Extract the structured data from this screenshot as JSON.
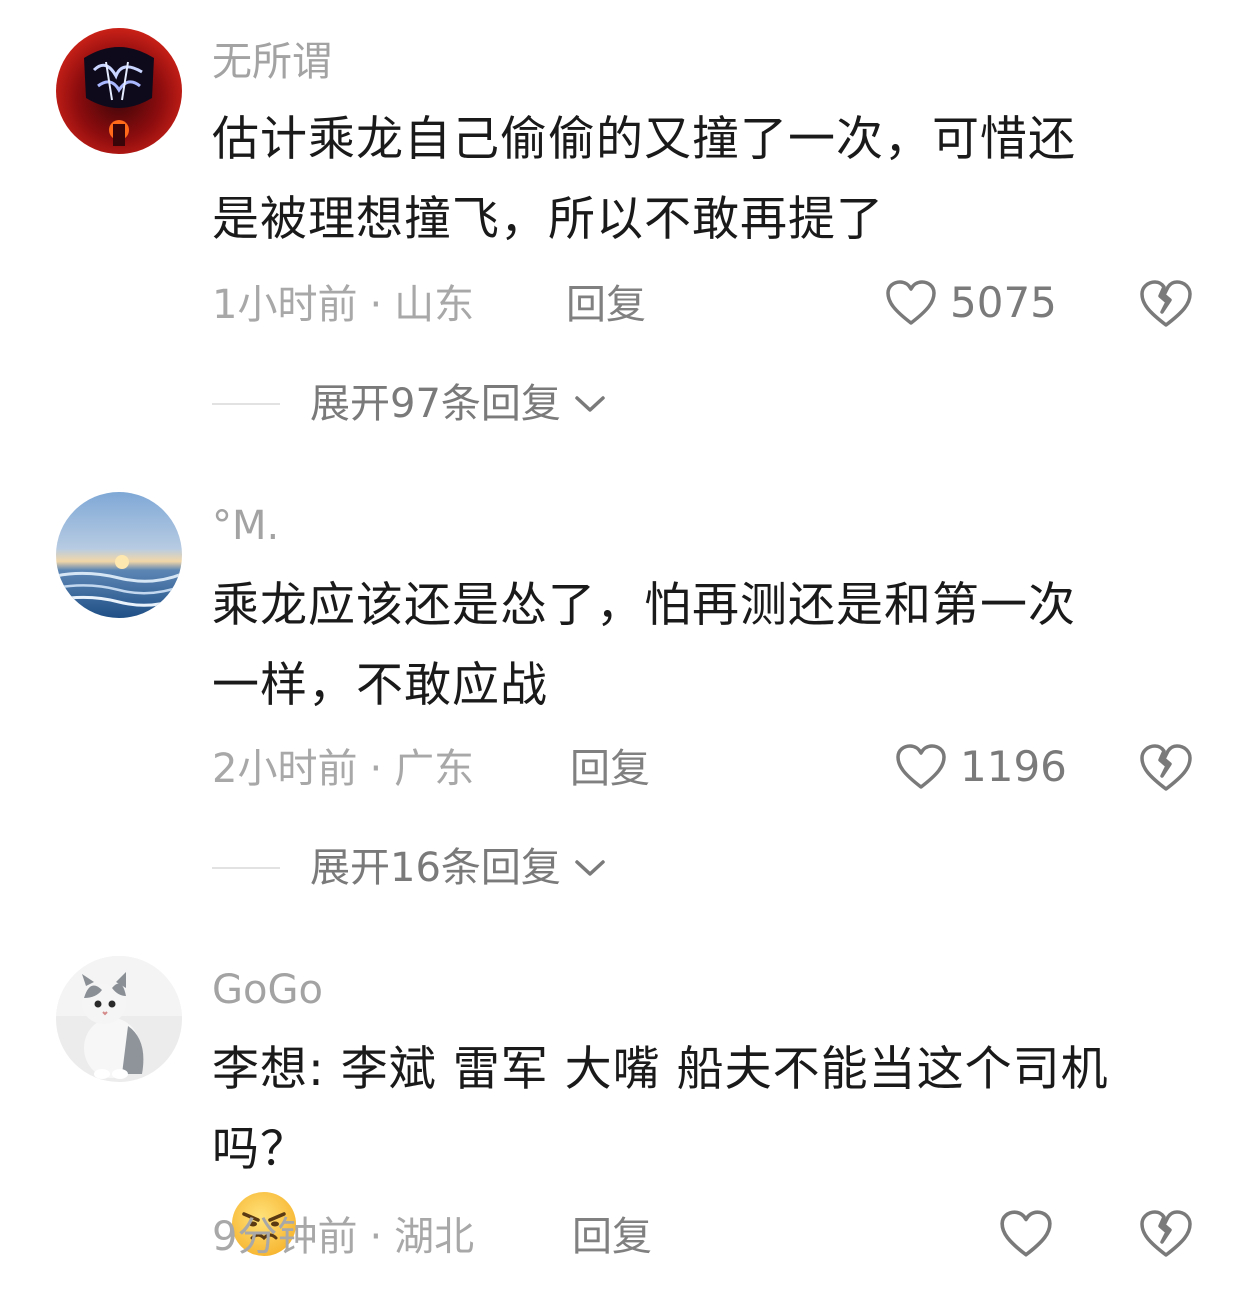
{
  "comments": [
    {
      "username": "无所谓",
      "lines": [
        "估计乘龙自己偷偷的又撞了一次，可惜还",
        "是被理想撞飞，所以不敢再提了"
      ],
      "time": "1小时前",
      "separator": "·",
      "location": "山东",
      "reply_label": "回复",
      "like_count": "5075",
      "expand_label": "展开97条回复",
      "avatar_icon": "dark-red-flame-avatar"
    },
    {
      "username": "°M.",
      "lines": [
        "乘龙应该还是怂了，怕再测还是和第一次",
        "一样，不敢应战"
      ],
      "time": "2小时前",
      "separator": "·",
      "location": "广东",
      "reply_label": "回复",
      "like_count": "1196",
      "expand_label": "展开16条回复",
      "avatar_icon": "ocean-sunset-avatar"
    },
    {
      "username": "GoGo",
      "lines": [
        "李想: 李斌 雷军 大嘴 船夫不能当这个司机",
        "吗？"
      ],
      "time": "9分钟前",
      "separator": "·",
      "location": "湖北",
      "reply_label": "回复",
      "like_count": "",
      "avatar_icon": "grey-white-kitten-avatar",
      "emoji_icon": "annoyed-face-emoji"
    }
  ],
  "colors": {
    "username": "#a3a3a3",
    "body": "#1a1a1a",
    "meta": "#a8a8a8",
    "action": "#7a7a7a",
    "divider": "#e2e2e2"
  },
  "icons": {
    "like": "heart-outline-icon",
    "dislike": "broken-heart-icon",
    "expand": "chevron-down-icon"
  }
}
